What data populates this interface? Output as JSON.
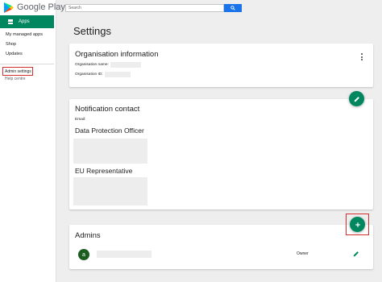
{
  "brand": {
    "name": "Google Play"
  },
  "search": {
    "placeholder": "Search"
  },
  "sidebar": {
    "apps_label": "Apps",
    "items": [
      "My managed apps",
      "Shop",
      "Updates"
    ],
    "admin_settings": "Admin settings",
    "help_centre": "Help centre"
  },
  "page": {
    "title": "Settings"
  },
  "org": {
    "title": "Organisation information",
    "name_label": "Organisation name:",
    "id_label": "Organisation ID:"
  },
  "notification": {
    "title": "Notification contact",
    "email_label": "Email:",
    "dpo_title": "Data Protection Officer",
    "eu_title": "EU Representative"
  },
  "admins": {
    "title": "Admins",
    "rows": [
      {
        "avatar_letter": "a",
        "role": "Owner"
      }
    ]
  },
  "colors": {
    "accent": "#01875f",
    "highlight": "#d32f2f",
    "search_button": "#1a73e8"
  },
  "icons": [
    "play-logo-icon",
    "apps-grid-icon",
    "search-icon",
    "more-vert-icon",
    "edit-icon",
    "add-icon"
  ]
}
